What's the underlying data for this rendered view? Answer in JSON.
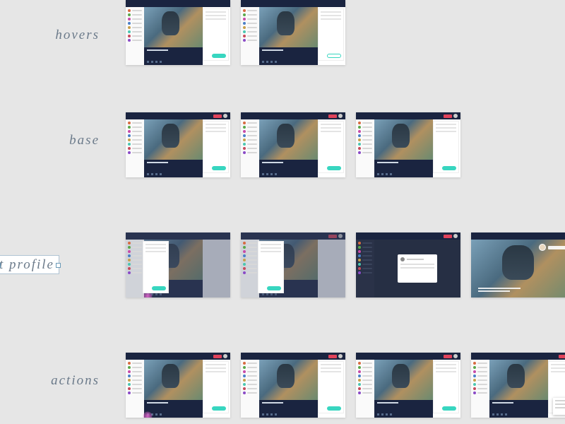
{
  "rows": {
    "hovers": {
      "label": "hovers"
    },
    "base": {
      "label": "base"
    },
    "profile": {
      "label": "t profile"
    },
    "actions": {
      "label": "actions"
    }
  },
  "sidebar_dots": [
    "#d86b42",
    "#5aa84a",
    "#c74aa8",
    "#4a7fc7",
    "#c7a04a",
    "#4ac7b0",
    "#c74a5a",
    "#8a4ac7"
  ],
  "accent": "#38d6c0",
  "danger": "#e0425a",
  "navy": "#1a2440"
}
